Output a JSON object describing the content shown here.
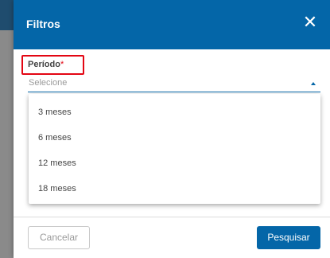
{
  "modal": {
    "title": "Filtros",
    "close_icon": "close-icon"
  },
  "periodo": {
    "label": "Período",
    "required_mark": "*",
    "placeholder": "Selecione",
    "options": [
      "3 meses",
      "6 meses",
      "12 meses",
      "18 meses"
    ]
  },
  "footer": {
    "cancel_label": "Cancelar",
    "search_label": "Pesquisar"
  },
  "colors": {
    "primary": "#0466a8",
    "required": "#e30613"
  }
}
